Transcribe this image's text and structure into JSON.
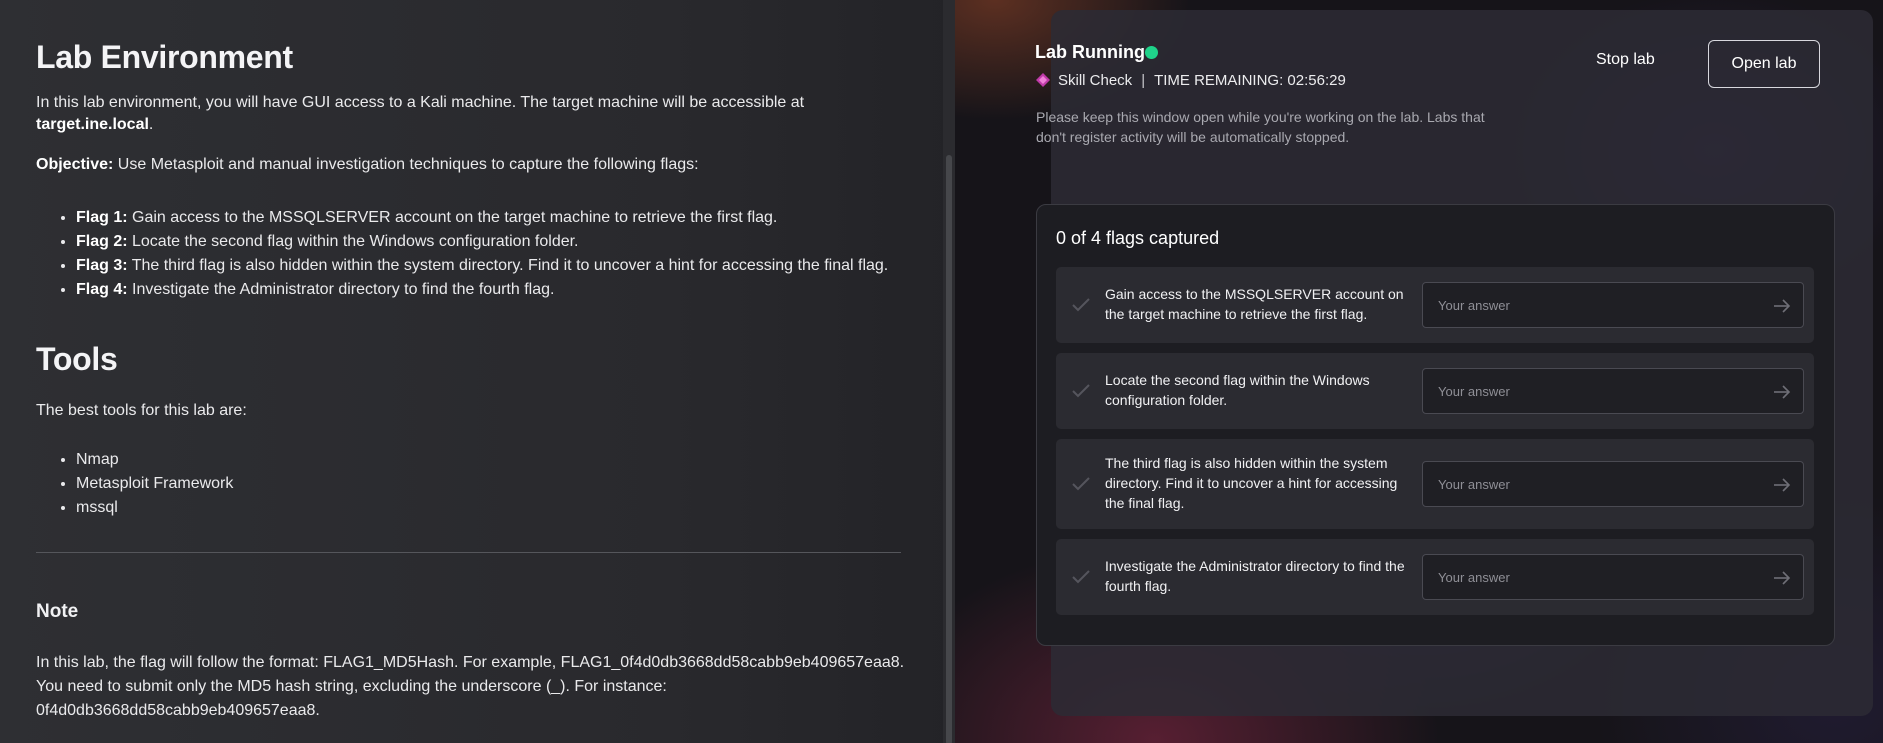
{
  "instructions": {
    "title": "Lab Environment",
    "intro_text": "In this lab environment, you will have GUI access to a Kali machine. The target machine will be accessible at ",
    "intro_host": "target.ine.local",
    "intro_end": ".",
    "objective_label": "Objective:",
    "objective_text": " Use Metasploit and manual investigation techniques to capture the following flags:",
    "flags": [
      {
        "label": "Flag 1:",
        "text": " Gain access to the MSSQLSERVER account on the target machine to retrieve the first flag."
      },
      {
        "label": "Flag 2:",
        "text": " Locate the second flag within the Windows configuration folder."
      },
      {
        "label": "Flag 3:",
        "text": " The third flag is also hidden within the system directory. Find it to uncover a hint for accessing the final flag."
      },
      {
        "label": "Flag 4:",
        "text": " Investigate the Administrator directory to find the fourth flag."
      }
    ],
    "tools_title": "Tools",
    "tools_intro": "The best tools for this lab are:",
    "tools": [
      "Nmap",
      "Metasploit Framework",
      "mssql"
    ],
    "note_title": "Note",
    "note_line1": "In this lab, the flag will follow the format: FLAG1_MD5Hash. For example, FLAG1_0f4d0db3668dd58cabb9eb409657eaa8.",
    "note_line2": "You need to submit only the MD5 hash string, excluding the underscore (_). For instance:",
    "note_line3": "0f4d0db3668dd58cabb9eb409657eaa8."
  },
  "lab_status": {
    "title": "Lab Running",
    "status_color": "#1fd38a",
    "type_label": "Skill Check",
    "type_icon": "diamond-icon",
    "separator": "|",
    "time_remaining": "TIME REMAINING: 02:56:29",
    "notice": "Please keep this window open while you're working on the lab. Labs that don't register activity will be automatically stopped.",
    "stop_label": "Stop lab",
    "open_label": "Open lab"
  },
  "flags_panel": {
    "captured_text": "0 of 4 flags captured",
    "items": [
      {
        "question": "Gain access to the MSSQLSERVER account on the target machine to retrieve the first flag.",
        "placeholder": "Your answer",
        "value": ""
      },
      {
        "question": "Locate the second flag within the Windows configuration folder.",
        "placeholder": "Your answer",
        "value": ""
      },
      {
        "question": "The third flag is also hidden within the system directory. Find it to uncover a hint for accessing the final flag.",
        "placeholder": "Your answer",
        "value": ""
      },
      {
        "question": "Investigate the Administrator directory to find the fourth flag.",
        "placeholder": "Your answer",
        "value": ""
      }
    ]
  }
}
